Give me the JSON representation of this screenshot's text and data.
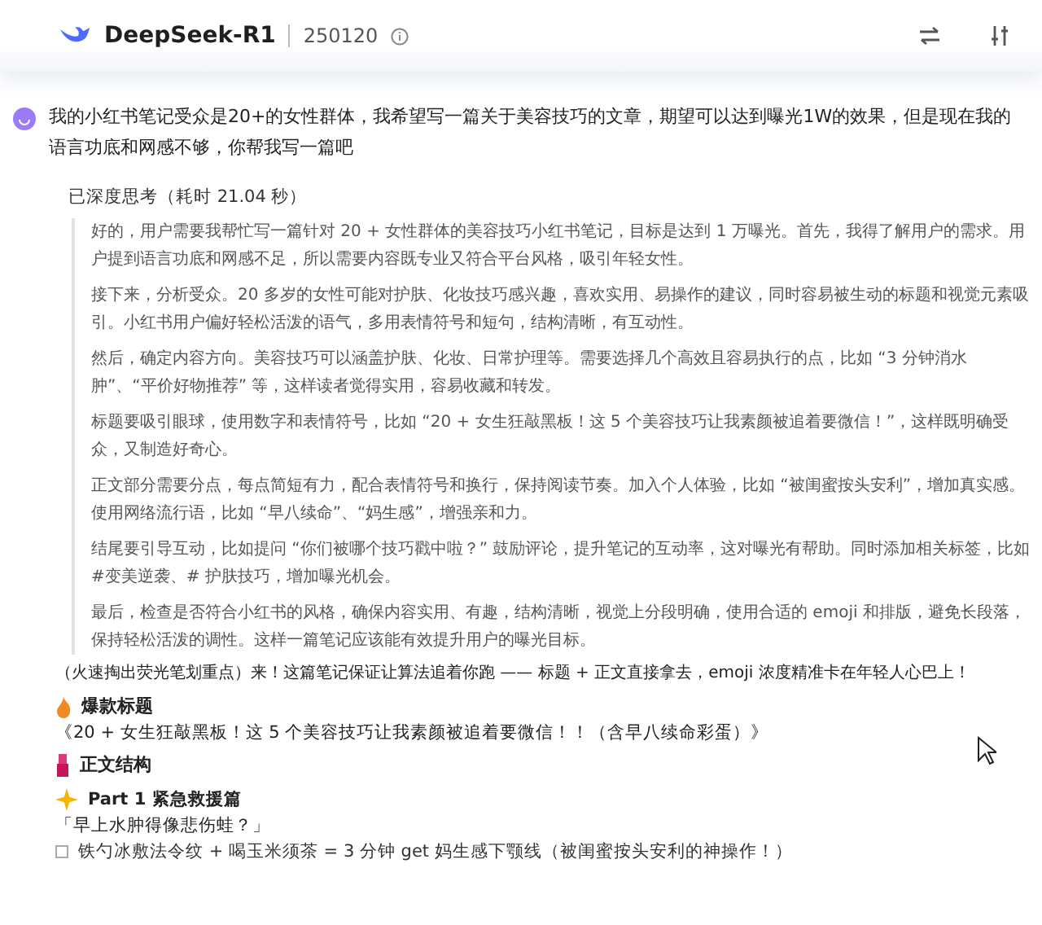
{
  "header": {
    "model": "DeepSeek-R1",
    "version": "250120"
  },
  "user_message": {
    "text": "我的小红书笔记受众是20+的女性群体，我希望写一篇关于美容技巧的文章，期望可以达到曝光1W的效果，但是现在我的语言功底和网感不够，你帮我写一篇吧"
  },
  "thinking": {
    "label": "已深度思考（耗时 21.04 秒）",
    "paragraphs": [
      "好的，用户需要我帮忙写一篇针对 20 + 女性群体的美容技巧小红书笔记，目标是达到 1 万曝光。首先，我得了解用户的需求。用户提到语言功底和网感不足，所以需要内容既专业又符合平台风格，吸引年轻女性。",
      "接下来，分析受众。20 多岁的女性可能对护肤、化妆技巧感兴趣，喜欢实用、易操作的建议，同时容易被生动的标题和视觉元素吸引。小红书用户偏好轻松活泼的语气，多用表情符号和短句，结构清晰，有互动性。",
      "然后，确定内容方向。美容技巧可以涵盖护肤、化妆、日常护理等。需要选择几个高效且容易执行的点，比如 “3 分钟消水肿”、“平价好物推荐” 等，这样读者觉得实用，容易收藏和转发。",
      "标题要吸引眼球，使用数字和表情符号，比如 “20 + 女生狂敲黑板！这 5 个美容技巧让我素颜被追着要微信！”，这样既明确受众，又制造好奇心。",
      "正文部分需要分点，每点简短有力，配合表情符号和换行，保持阅读节奏。加入个人体验，比如 “被闺蜜按头安利”，增加真实感。使用网络流行语，比如 “早八续命”、“妈生感”，增强亲和力。",
      "结尾要引导互动，比如提问 “你们被哪个技巧戳中啦？” 鼓励评论，提升笔记的互动率，这对曝光有帮助。同时添加相关标签，比如 #变美逆袭、# 护肤技巧，增加曝光机会。",
      "最后，检查是否符合小红书的风格，确保内容实用、有趣，结构清晰，视觉上分段明确，使用合适的 emoji 和排版，避免长段落，保持轻松活泼的调性。这样一篇笔记应该能有效提升用户的曝光目标。"
    ]
  },
  "answer": {
    "intro": "（火速掏出荧光笔划重点）来！这篇笔记保证让算法追着你跑 —— 标题 + 正文直接拿去，emoji 浓度精准卡在年轻人心巴上！",
    "blocks": [
      {
        "kind": "heading",
        "text": "爆款标题"
      },
      {
        "kind": "line",
        "text": "《20 + 女生狂敲黑板！这 5 个美容技巧让我素颜被追着要微信！！（含早八续命彩蛋）》"
      },
      {
        "kind": "heading",
        "text": "正文结构"
      },
      {
        "kind": "subheading",
        "text": "Part 1 紧急救援篇"
      },
      {
        "kind": "line",
        "text": "「早上水肿得像悲伤蛙？」"
      },
      {
        "kind": "bullet",
        "text": "铁勺冰敷法令纹 + 喝玉米须茶 = 3 分钟 get 妈生感下颚线（被闺蜜按头安利的神操作！）"
      }
    ]
  }
}
